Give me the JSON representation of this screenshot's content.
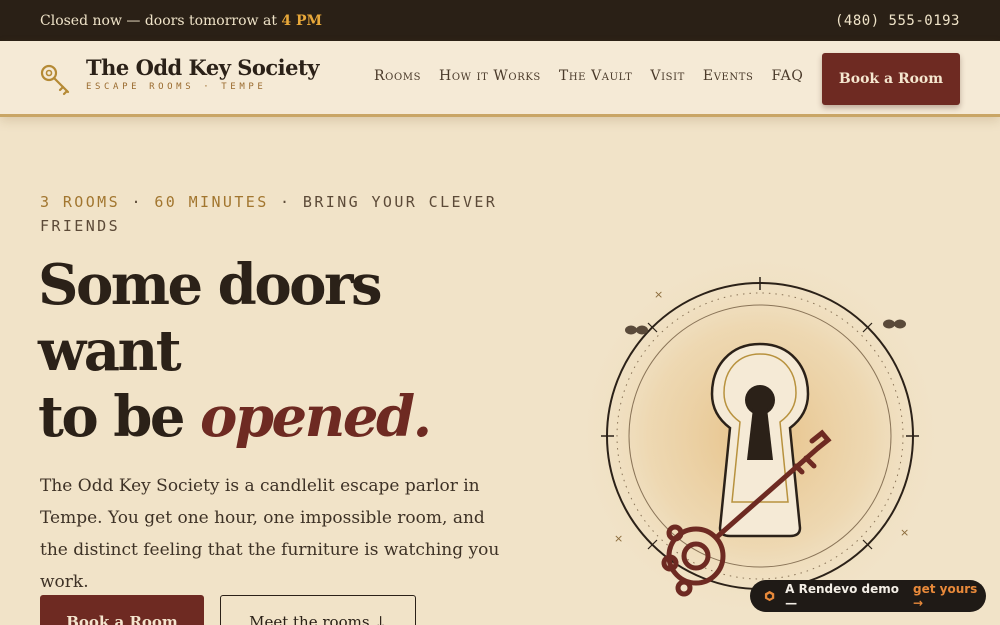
{
  "topbar": {
    "status_prefix": "Closed now — doors tomorrow at ",
    "status_time": "4 PM",
    "phone": "(480) 555-0193"
  },
  "brand": {
    "name": "The Odd Key Society",
    "tagline": "ESCAPE ROOMS · TEMPE"
  },
  "nav": {
    "items": [
      {
        "label": "Rooms"
      },
      {
        "label": "How it Works"
      },
      {
        "label": "The Vault"
      },
      {
        "label": "Visit"
      },
      {
        "label": "Events"
      },
      {
        "label": "FAQ"
      }
    ],
    "cta": "Book a Room"
  },
  "hero": {
    "eyebrow_rooms": "3 ROOMS",
    "eyebrow_sep1": " · ",
    "eyebrow_minutes": "60 MINUTES",
    "eyebrow_rest": " · BRING YOUR CLEVER FRIENDS",
    "headline_line1": "Some doors",
    "headline_line2": "want",
    "headline_line3": "to be ",
    "headline_accent": "opened.",
    "lede": "The Odd Key Society is a candlelit escape parlor in Tempe. You get one hour, one impossible room, and the distinct feeling that the furniture is watching you work.",
    "primary_button": "Book a Room",
    "secondary_button": "Meet the rooms ↓"
  },
  "demo_badge": {
    "text": "A Rendevo demo —",
    "link": "get yours →"
  },
  "colors": {
    "accent": "#6e2a22",
    "gold": "#c9a666",
    "dark": "#2a2016",
    "background": "#f1e3c8"
  },
  "icons": {
    "brand": "key-icon",
    "illustration": "keyhole-icon",
    "demo": "rendevo-logo-icon"
  }
}
